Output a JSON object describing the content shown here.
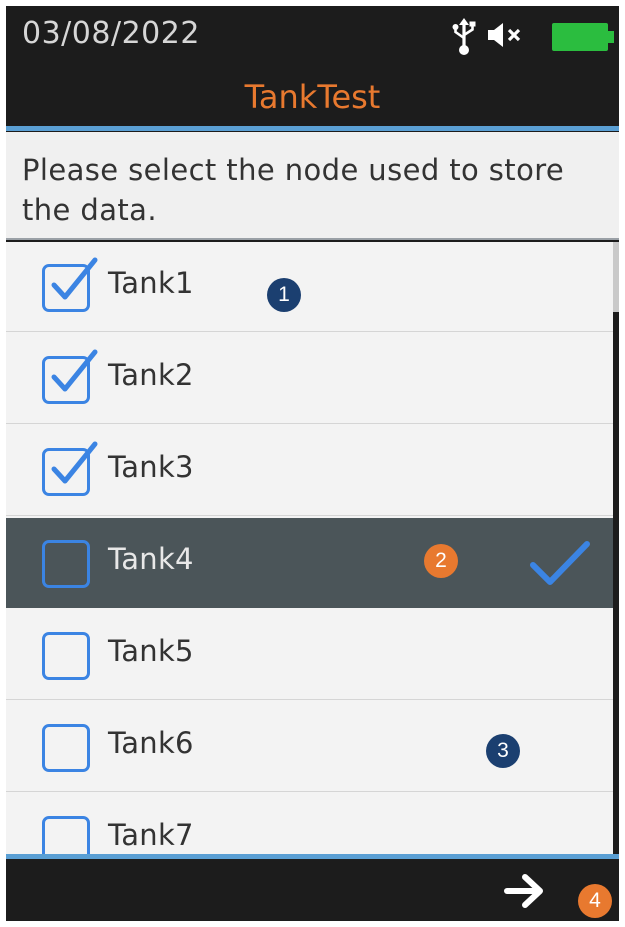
{
  "status": {
    "date": "03/08/2022",
    "icons": [
      "usb-icon",
      "speaker-muted-icon",
      "battery-full-icon"
    ]
  },
  "header": {
    "title": "TankTest"
  },
  "prompt": {
    "text": "Please select the node used to store the data."
  },
  "list": {
    "items": [
      {
        "label": "Tank1",
        "checked": true,
        "highlighted": false
      },
      {
        "label": "Tank2",
        "checked": true,
        "highlighted": false
      },
      {
        "label": "Tank3",
        "checked": true,
        "highlighted": false
      },
      {
        "label": "Tank4",
        "checked": false,
        "highlighted": true
      },
      {
        "label": "Tank5",
        "checked": false,
        "highlighted": false
      },
      {
        "label": "Tank6",
        "checked": false,
        "highlighted": false
      },
      {
        "label": "Tank7",
        "checked": false,
        "highlighted": false
      }
    ]
  },
  "footer": {
    "next_icon": "arrow-right-icon"
  },
  "callouts": [
    "1",
    "2",
    "3",
    "4"
  ],
  "colors": {
    "accent_orange": "#e8792f",
    "checkbox_blue": "#3b84e3",
    "divider_blue": "#5a9fd4",
    "callout_navy": "#1b3f70"
  }
}
